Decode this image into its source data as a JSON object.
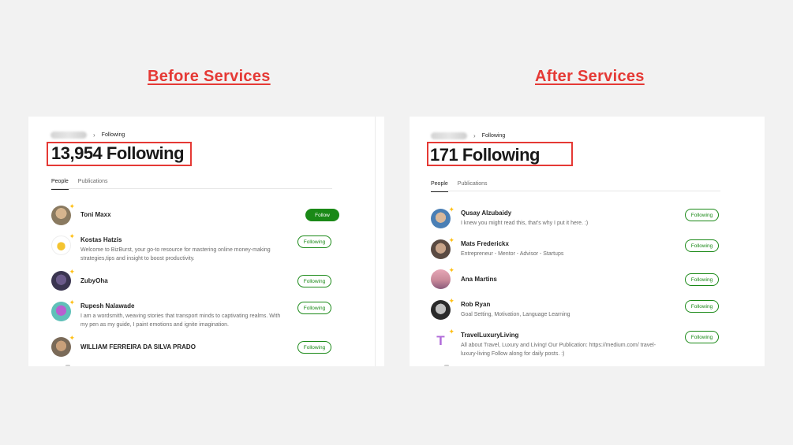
{
  "headings": {
    "before": "Before Services",
    "after": "After Services"
  },
  "before": {
    "breadcrumb": "Following",
    "title": "13,954 Following",
    "tabs": [
      "People",
      "Publications"
    ],
    "users": [
      {
        "name": "Toni Maxx",
        "bio": "",
        "button": "Follow",
        "variant": "follow",
        "avatar_color": "#8a7a60"
      },
      {
        "name": "Kostas Hatzis",
        "bio": "Welcome to BizBurst, your go-to resource for mastering online money-making strategies,tips and insight to boost productivity.",
        "button": "Following",
        "variant": "following",
        "avatar_color": "#f4c430"
      },
      {
        "name": "ZubyOha",
        "bio": "",
        "button": "Following",
        "variant": "following",
        "avatar_color": "#3a3550"
      },
      {
        "name": "Rupesh Nalawade",
        "bio": "I am a wordsmith, weaving stories that transport minds to captivating realms. With my pen as my guide, I paint emotions and ignite imagination.",
        "button": "Following",
        "variant": "following",
        "avatar_color": "#5fc0b8"
      },
      {
        "name": "WILLIAM FERREIRA DA SILVA PRADO",
        "bio": "",
        "button": "Following",
        "variant": "following",
        "avatar_color": "#7a6a58"
      }
    ]
  },
  "after": {
    "breadcrumb": "Following",
    "title": "171 Following",
    "tabs": [
      "People",
      "Publications"
    ],
    "users": [
      {
        "name": "Qusay Alzubaidy",
        "bio": "I knew you might read this, that's why I put it here. :)",
        "button": "Following",
        "variant": "following",
        "avatar_color": "#4a7fb5"
      },
      {
        "name": "Mats Frederickx",
        "bio": "Entrepreneur - Mentor - Advisor - Startups",
        "button": "Following",
        "variant": "following",
        "avatar_color": "#5a4a42"
      },
      {
        "name": "Ana Martins",
        "bio": "",
        "button": "Following",
        "variant": "following",
        "avatar_color": "#c98a9a"
      },
      {
        "name": "Rob Ryan",
        "bio": "Goal Setting, Motivation, Language Learning",
        "button": "Following",
        "variant": "following",
        "avatar_color": "#2a2a2a"
      },
      {
        "name": "TravelLuxuryLiving",
        "bio": "All about Travel, Luxury and Living! Our Publication: https://medium.com/ travel-luxury-living Follow along for daily posts. :)",
        "button": "Following",
        "variant": "following",
        "avatar_color": "#ffffff",
        "avatar_letter": "T",
        "avatar_letter_color": "#b06ad9"
      }
    ]
  }
}
